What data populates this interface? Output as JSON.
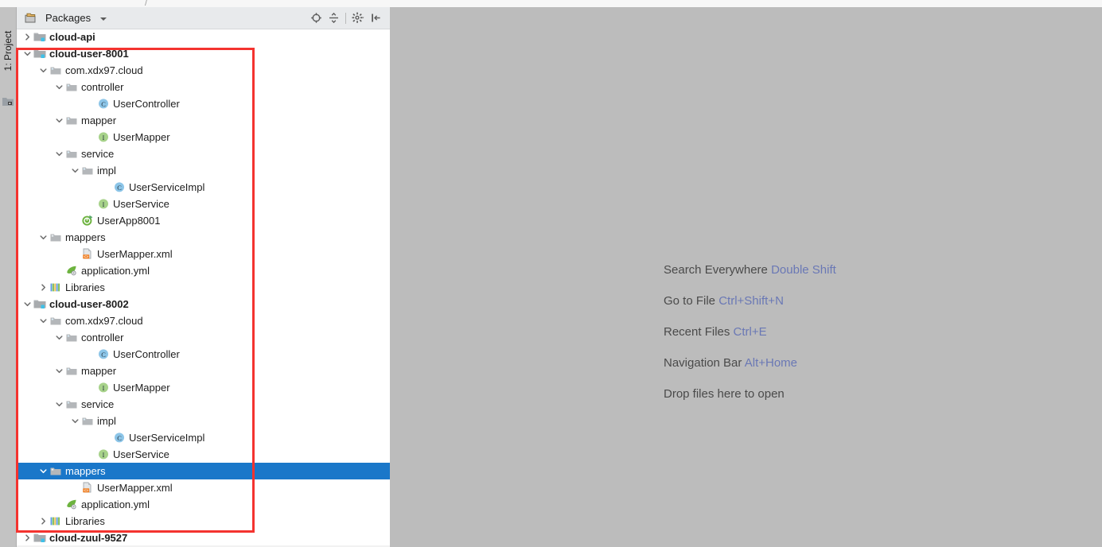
{
  "window": {
    "breadcrumb_fragment": "",
    "breadcrumb_separator": "/"
  },
  "tool_rail": {
    "tab_label": "1: Project",
    "tab_icon": "project-module-icon"
  },
  "panel": {
    "title": "Packages",
    "title_icon": "packages-icon",
    "dropdown_icon": "chevron-down-icon",
    "toolbar": [
      {
        "name": "scroll-from-source-button",
        "icon": "locate-target-icon",
        "tooltip": "Select Opened File"
      },
      {
        "name": "collapse-all-button",
        "icon": "collapse-all-icon",
        "tooltip": "Collapse All"
      },
      {
        "name": "settings-button",
        "icon": "gear-icon",
        "tooltip": "Settings"
      },
      {
        "name": "hide-button",
        "icon": "hide-panel-icon",
        "tooltip": "Hide"
      }
    ]
  },
  "colors": {
    "selection_blue": "#1a77c9",
    "annotation_red": "#f4332f",
    "editor_background": "#bcbcbc",
    "panel_header": "#e8eaec",
    "shortcut_key": "#6a78b5",
    "class_icon": "#8cc5e8",
    "interface_icon": "#a7d28a",
    "module_badge": "#3fc0e8"
  },
  "tree": {
    "rows": [
      {
        "label": "cloud-api",
        "depth": 0,
        "twisty": "collapsed",
        "icon": "module-folder-icon",
        "bold": true,
        "selected": false
      },
      {
        "label": "cloud-user-8001",
        "depth": 0,
        "twisty": "expanded",
        "icon": "module-folder-icon",
        "bold": true,
        "selected": false
      },
      {
        "label": "com.xdx97.cloud",
        "depth": 1,
        "twisty": "expanded",
        "icon": "package-folder-icon",
        "bold": false,
        "selected": false
      },
      {
        "label": "controller",
        "depth": 2,
        "twisty": "expanded",
        "icon": "package-folder-icon",
        "bold": false,
        "selected": false
      },
      {
        "label": "UserController",
        "depth": 4,
        "twisty": "none",
        "icon": "class-icon",
        "bold": false,
        "selected": false
      },
      {
        "label": "mapper",
        "depth": 2,
        "twisty": "expanded",
        "icon": "package-folder-icon",
        "bold": false,
        "selected": false
      },
      {
        "label": "UserMapper",
        "depth": 4,
        "twisty": "none",
        "icon": "interface-icon",
        "bold": false,
        "selected": false
      },
      {
        "label": "service",
        "depth": 2,
        "twisty": "expanded",
        "icon": "package-folder-icon",
        "bold": false,
        "selected": false
      },
      {
        "label": "impl",
        "depth": 3,
        "twisty": "expanded",
        "icon": "package-folder-icon",
        "bold": false,
        "selected": false
      },
      {
        "label": "UserServiceImpl",
        "depth": 5,
        "twisty": "none",
        "icon": "class-icon",
        "bold": false,
        "selected": false
      },
      {
        "label": "UserService",
        "depth": 4,
        "twisty": "none",
        "icon": "interface-icon",
        "bold": false,
        "selected": false
      },
      {
        "label": "UserApp8001",
        "depth": 3,
        "twisty": "none",
        "icon": "spring-boot-run-icon",
        "bold": false,
        "selected": false
      },
      {
        "label": "mappers",
        "depth": 1,
        "twisty": "expanded",
        "icon": "resource-folder-icon",
        "bold": false,
        "selected": false
      },
      {
        "label": "UserMapper.xml",
        "depth": 3,
        "twisty": "none",
        "icon": "xml-file-icon",
        "bold": false,
        "selected": false
      },
      {
        "label": "application.yml",
        "depth": 2,
        "twisty": "none",
        "icon": "yaml-spring-icon",
        "bold": false,
        "selected": false
      },
      {
        "label": "Libraries",
        "depth": 1,
        "twisty": "collapsed",
        "icon": "libraries-icon",
        "bold": false,
        "selected": false
      },
      {
        "label": "cloud-user-8002",
        "depth": 0,
        "twisty": "expanded",
        "icon": "module-folder-icon",
        "bold": true,
        "selected": false
      },
      {
        "label": "com.xdx97.cloud",
        "depth": 1,
        "twisty": "expanded",
        "icon": "package-folder-icon",
        "bold": false,
        "selected": false
      },
      {
        "label": "controller",
        "depth": 2,
        "twisty": "expanded",
        "icon": "package-folder-icon",
        "bold": false,
        "selected": false
      },
      {
        "label": "UserController",
        "depth": 4,
        "twisty": "none",
        "icon": "class-icon",
        "bold": false,
        "selected": false
      },
      {
        "label": "mapper",
        "depth": 2,
        "twisty": "expanded",
        "icon": "package-folder-icon",
        "bold": false,
        "selected": false
      },
      {
        "label": "UserMapper",
        "depth": 4,
        "twisty": "none",
        "icon": "interface-icon",
        "bold": false,
        "selected": false
      },
      {
        "label": "service",
        "depth": 2,
        "twisty": "expanded",
        "icon": "package-folder-icon",
        "bold": false,
        "selected": false
      },
      {
        "label": "impl",
        "depth": 3,
        "twisty": "expanded",
        "icon": "package-folder-icon",
        "bold": false,
        "selected": false
      },
      {
        "label": "UserServiceImpl",
        "depth": 5,
        "twisty": "none",
        "icon": "class-icon",
        "bold": false,
        "selected": false
      },
      {
        "label": "UserService",
        "depth": 4,
        "twisty": "none",
        "icon": "interface-icon",
        "bold": false,
        "selected": false
      },
      {
        "label": "mappers",
        "depth": 1,
        "twisty": "expanded",
        "icon": "resource-folder-icon",
        "bold": false,
        "selected": true
      },
      {
        "label": "UserMapper.xml",
        "depth": 3,
        "twisty": "none",
        "icon": "xml-file-icon",
        "bold": false,
        "selected": false
      },
      {
        "label": "application.yml",
        "depth": 2,
        "twisty": "none",
        "icon": "yaml-spring-icon",
        "bold": false,
        "selected": false
      },
      {
        "label": "Libraries",
        "depth": 1,
        "twisty": "collapsed",
        "icon": "libraries-icon",
        "bold": false,
        "selected": false
      },
      {
        "label": "cloud-zuul-9527",
        "depth": 0,
        "twisty": "collapsed",
        "icon": "module-folder-icon",
        "bold": true,
        "selected": false
      }
    ]
  },
  "editor": {
    "hints": [
      {
        "action": "Search Everywhere",
        "shortcut": "Double Shift"
      },
      {
        "action": "Go to File",
        "shortcut": "Ctrl+Shift+N"
      },
      {
        "action": "Recent Files",
        "shortcut": "Ctrl+E"
      },
      {
        "action": "Navigation Bar",
        "shortcut": "Alt+Home"
      },
      {
        "action": "Drop files here to open",
        "shortcut": ""
      }
    ]
  }
}
